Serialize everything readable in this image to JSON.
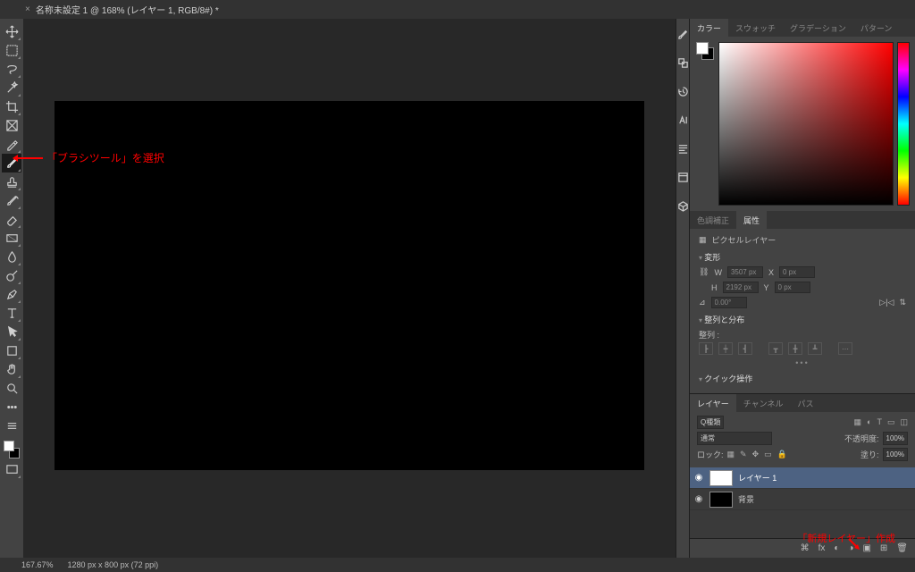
{
  "doc_tab": {
    "title": "名称未設定 1 @ 168% (レイヤー 1, RGB/8#) *",
    "close": "×"
  },
  "annotations": {
    "brush_select": "「ブラシツール」を選択",
    "new_layer": "「新規レイヤー」作成"
  },
  "panels": {
    "color_tabs": [
      "カラー",
      "スウォッチ",
      "グラデーション",
      "パターン"
    ],
    "props_tabs": [
      "色調補正",
      "属性"
    ],
    "layer_tabs": [
      "レイヤー",
      "チャンネル",
      "パス"
    ]
  },
  "properties": {
    "type_label": "ピクセルレイヤー",
    "transform_label": "変形",
    "w": "3507 px",
    "x": "0 px",
    "h": "2192 px",
    "y": "0 px",
    "angle": "0.00°",
    "align_label": "整列と分布",
    "align_sub": "整列 :",
    "quick_label": "クイック操作"
  },
  "layers": {
    "filter_kind": "Q種類",
    "blend_mode": "通常",
    "opacity_label": "不透明度:",
    "opacity_val": "100%",
    "lock_label": "ロック:",
    "fill_label": "塗り:",
    "fill_val": "100%",
    "items": [
      {
        "name": "レイヤー 1",
        "selected": true,
        "thumb": "white"
      },
      {
        "name": "背景",
        "selected": false,
        "thumb": "black"
      }
    ],
    "footer_fx": "fx"
  },
  "status": {
    "zoom": "167.67%",
    "dims": "1280 px x 800 px (72 ppi)"
  }
}
